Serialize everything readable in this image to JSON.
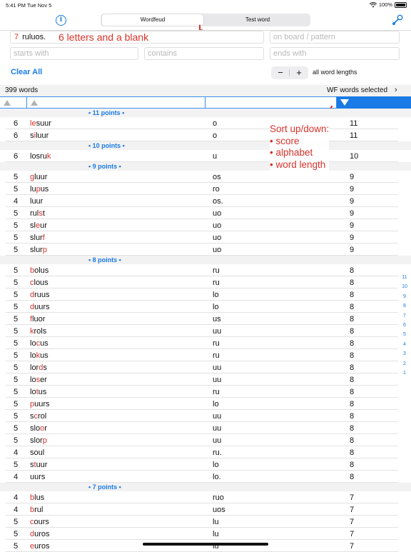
{
  "status_bar": {
    "time": "5:41 PM",
    "date": "Tue Nov 5",
    "battery": "100%"
  },
  "toolbar": {
    "info_icon": "info-icon",
    "tabs": [
      {
        "label": "Wordfeud",
        "selected": true
      },
      {
        "label": "Test word",
        "selected": false
      }
    ],
    "tool_icon": "wrench-icon"
  },
  "inputs": {
    "letters_count": "7",
    "letters_value": "ruluos.",
    "board_placeholder": "on board / pattern",
    "starts_placeholder": "starts with",
    "contains_placeholder": "contains",
    "ends_placeholder": "ends with"
  },
  "annotations": {
    "letters": "6 letters and a blank",
    "sort_lines": [
      "Sort up/down:",
      "• score",
      "• alphabet",
      "• word length"
    ]
  },
  "controls": {
    "clear_all": "Clear All",
    "minus": "−",
    "plus": "+",
    "word_lengths": "all word lengths"
  },
  "summary": {
    "word_count": "399 words",
    "wf_selected": "WF words selected",
    "chevron": "›"
  },
  "list": [
    {
      "header": "• 11 points •"
    },
    {
      "len": "6",
      "pre": "",
      "red": "le",
      "post": "suur",
      "extra": "o",
      "score": "11"
    },
    {
      "len": "6",
      "pre": "s",
      "red": "i",
      "post": "luur",
      "extra": "o",
      "score": "11"
    },
    {
      "header": "• 10 points •"
    },
    {
      "len": "6",
      "pre": "losru",
      "red": "k",
      "post": "",
      "extra": "u",
      "score": "10"
    },
    {
      "header": "• 9 points •"
    },
    {
      "len": "5",
      "pre": "",
      "red": "g",
      "post": "luur",
      "extra": "os",
      "score": "9"
    },
    {
      "len": "5",
      "pre": "lu",
      "red": "p",
      "post": "us",
      "extra": "ro",
      "score": "9"
    },
    {
      "len": "4",
      "pre": "luur",
      "red": "",
      "post": "",
      "extra": "os.",
      "score": "9"
    },
    {
      "len": "5",
      "pre": "rul",
      "red": "s",
      "post": "t",
      "extra": "uo",
      "score": "9"
    },
    {
      "len": "5",
      "pre": "sl",
      "red": "e",
      "post": "ur",
      "extra": "uo",
      "score": "9"
    },
    {
      "len": "5",
      "pre": "slur",
      "red": "f",
      "post": "",
      "extra": "uo",
      "score": "9"
    },
    {
      "len": "5",
      "pre": "slur",
      "red": "p",
      "post": "",
      "extra": "uo",
      "score": "9"
    },
    {
      "header": "• 8 points •"
    },
    {
      "len": "5",
      "pre": "",
      "red": "b",
      "post": "olus",
      "extra": "ru",
      "score": "8"
    },
    {
      "len": "5",
      "pre": "",
      "red": "c",
      "post": "lous",
      "extra": "ru",
      "score": "8"
    },
    {
      "len": "5",
      "pre": "",
      "red": "d",
      "post": "ruus",
      "extra": "lo",
      "score": "8"
    },
    {
      "len": "5",
      "pre": "",
      "red": "d",
      "post": "uurs",
      "extra": "lo",
      "score": "8"
    },
    {
      "len": "5",
      "pre": "",
      "red": "f",
      "post": "luor",
      "extra": "us",
      "score": "8"
    },
    {
      "len": "5",
      "pre": "",
      "red": "k",
      "post": "rols",
      "extra": "uu",
      "score": "8"
    },
    {
      "len": "5",
      "pre": "lo",
      "red": "c",
      "post": "us",
      "extra": "ru",
      "score": "8"
    },
    {
      "len": "5",
      "pre": "lo",
      "red": "k",
      "post": "us",
      "extra": "ru",
      "score": "8"
    },
    {
      "len": "5",
      "pre": "lor",
      "red": "d",
      "post": "s",
      "extra": "uu",
      "score": "8"
    },
    {
      "len": "5",
      "pre": "lo",
      "red": "s",
      "post": "er",
      "extra": "uu",
      "score": "8"
    },
    {
      "len": "5",
      "pre": "lo",
      "red": "t",
      "post": "us",
      "extra": "ru",
      "score": "8"
    },
    {
      "len": "5",
      "pre": "",
      "red": "p",
      "post": "uurs",
      "extra": "lo",
      "score": "8"
    },
    {
      "len": "5",
      "pre": "s",
      "red": "c",
      "post": "rol",
      "extra": "uu",
      "score": "8"
    },
    {
      "len": "5",
      "pre": "slo",
      "red": "o",
      "post": "r",
      "extra": "uu",
      "score": "8"
    },
    {
      "len": "5",
      "pre": "slor",
      "red": "p",
      "post": "",
      "extra": "uu",
      "score": "8"
    },
    {
      "len": "4",
      "pre": "soul",
      "red": "",
      "post": "",
      "extra": "ru.",
      "score": "8"
    },
    {
      "len": "5",
      "pre": "s",
      "red": "t",
      "post": "uur",
      "extra": "lo",
      "score": "8"
    },
    {
      "len": "4",
      "pre": "uurs",
      "red": "",
      "post": "",
      "extra": "lo.",
      "score": "8"
    },
    {
      "header": "• 7 points •"
    },
    {
      "len": "4",
      "pre": "",
      "red": "b",
      "post": "lus",
      "extra": "ruo",
      "score": "7"
    },
    {
      "len": "4",
      "pre": "",
      "red": "b",
      "post": "rul",
      "extra": "uos",
      "score": "7"
    },
    {
      "len": "5",
      "pre": "",
      "red": "c",
      "post": "ours",
      "extra": "lu",
      "score": "7"
    },
    {
      "len": "5",
      "pre": "",
      "red": "d",
      "post": "uros",
      "extra": "lu",
      "score": "7"
    },
    {
      "len": "5",
      "pre": "",
      "red": "e",
      "post": "uros",
      "extra": "lu",
      "score": "7"
    }
  ],
  "index": [
    "11",
    "10",
    "9",
    "8",
    "7",
    "6",
    "5",
    "4",
    "3",
    "2",
    "1"
  ],
  "colors": {
    "accent": "#1a7be6",
    "annotation": "#d8332a"
  }
}
